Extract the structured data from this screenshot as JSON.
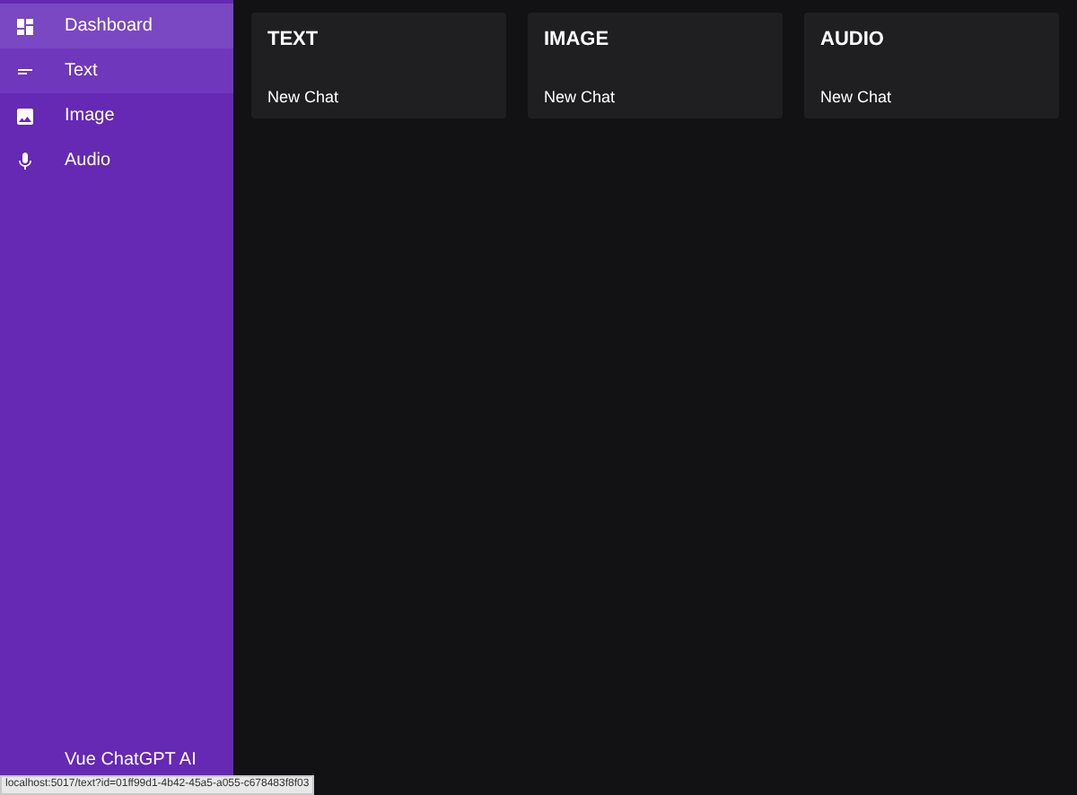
{
  "sidebar": {
    "items": [
      {
        "kind": "dashboard",
        "label": "Dashboard",
        "selected": true,
        "hovered": false
      },
      {
        "kind": "text",
        "label": "Text",
        "selected": false,
        "hovered": true
      },
      {
        "kind": "image",
        "label": "Image",
        "selected": false,
        "hovered": false
      },
      {
        "kind": "audio",
        "label": "Audio",
        "selected": false,
        "hovered": false
      }
    ],
    "footer": "Vue ChatGPT AI"
  },
  "cards": [
    {
      "title": "TEXT",
      "link": "New Chat"
    },
    {
      "title": "IMAGE",
      "link": "New Chat"
    },
    {
      "title": "AUDIO",
      "link": "New Chat"
    }
  ],
  "status_bar": "localhost:5017/text?id=01ff99d1-4b42-45a5-a055-c678483f8f03"
}
